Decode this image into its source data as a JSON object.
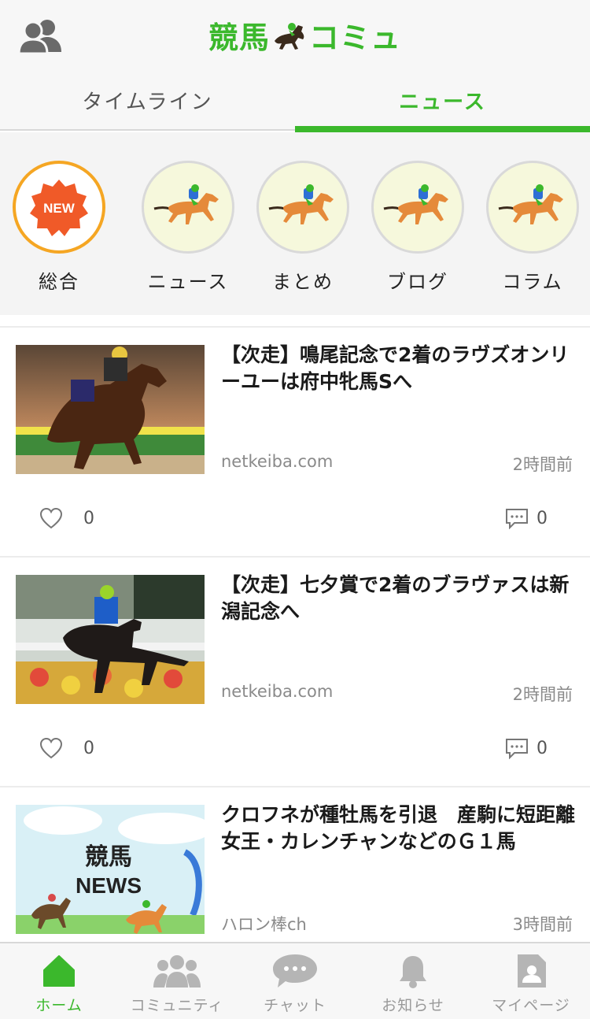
{
  "header": {
    "logo_text_left": "競馬",
    "logo_text_right": "コミュ",
    "tabs": [
      {
        "label": "タイムライン",
        "active": false
      },
      {
        "label": "ニュース",
        "active": true
      }
    ]
  },
  "categories": [
    {
      "label": "総合",
      "badge": "NEW",
      "active": true
    },
    {
      "label": "ニュース",
      "icon": "horse-racing-icon"
    },
    {
      "label": "まとめ",
      "icon": "horse-racing-icon"
    },
    {
      "label": "ブログ",
      "icon": "horse-racing-icon"
    },
    {
      "label": "コラム",
      "icon": "horse-racing-icon"
    }
  ],
  "articles": [
    {
      "title": "【次走】鳴尾記念で2着のラヴズオンリーユーは府中牝馬Sへ",
      "source": "netkeiba.com",
      "time": "2時間前",
      "likes": "0",
      "comments": "0"
    },
    {
      "title": "【次走】七夕賞で2着のブラヴァスは新潟記念へ",
      "source": "netkeiba.com",
      "time": "2時間前",
      "likes": "0",
      "comments": "0"
    },
    {
      "title": "クロフネが種牡馬を引退　産駒に短距離女王・カレンチャンなどのＧ１馬",
      "source": "ハロン棒ch",
      "time": "3時間前",
      "thumb_text_1": "競馬",
      "thumb_text_2": "NEWS"
    }
  ],
  "bottom_nav": [
    {
      "label": "ホーム",
      "icon": "home-icon",
      "active": true
    },
    {
      "label": "コミュニティ",
      "icon": "community-icon"
    },
    {
      "label": "チャット",
      "icon": "chat-icon"
    },
    {
      "label": "お知らせ",
      "icon": "bell-icon"
    },
    {
      "label": "マイページ",
      "icon": "profile-icon"
    }
  ],
  "colors": {
    "accent": "#3bb82c",
    "badge": "#f05a28",
    "active_ring": "#f5a623"
  }
}
